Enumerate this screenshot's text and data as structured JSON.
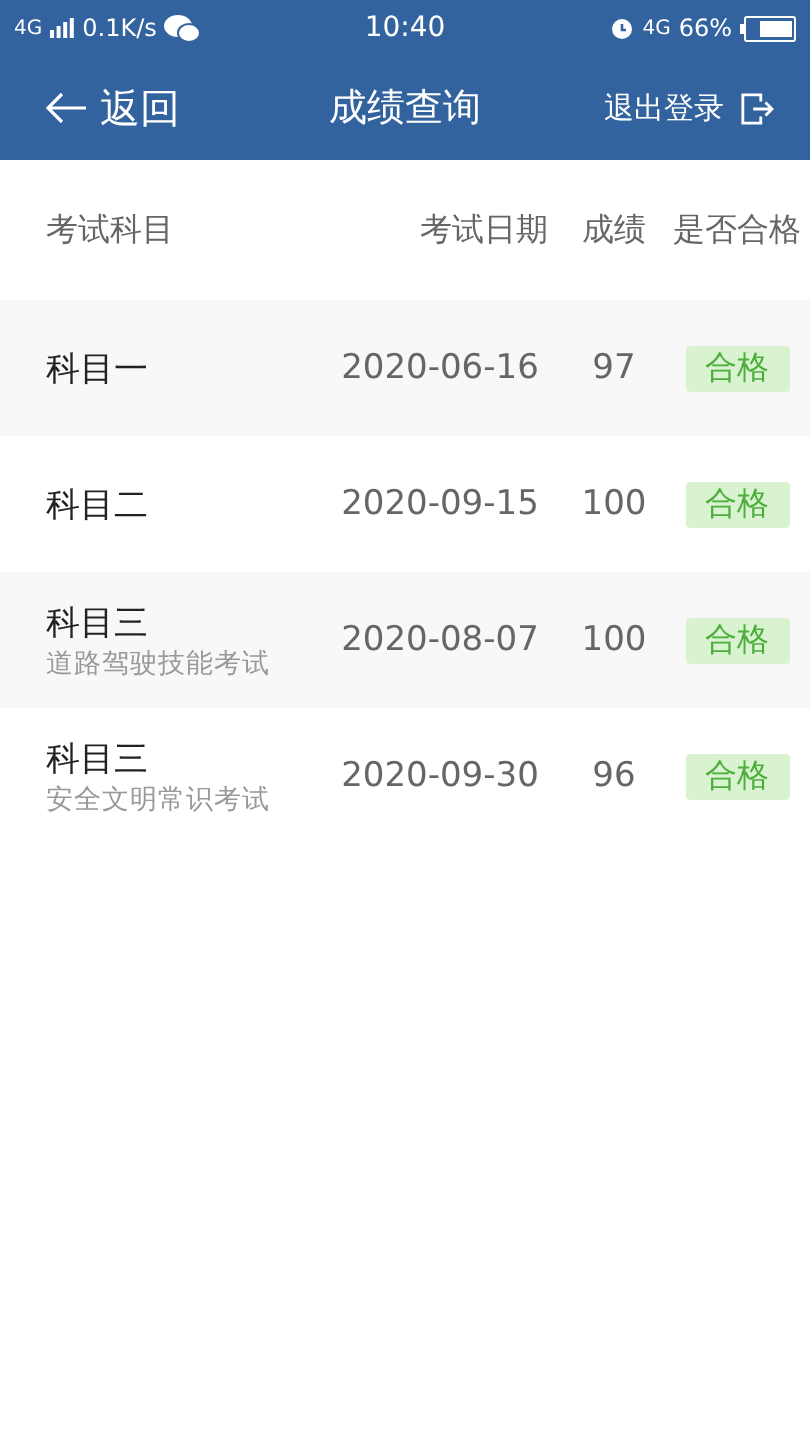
{
  "status_bar": {
    "network": "4G",
    "speed": "0.1K/s",
    "time": "10:40",
    "network_right": "4G",
    "battery": "66%"
  },
  "header": {
    "back": "返回",
    "title": "成绩查询",
    "logout": "退出登录"
  },
  "table": {
    "columns": [
      "考试科目",
      "考试日期",
      "成绩",
      "是否合格"
    ],
    "rows": [
      {
        "subject": "科目一",
        "date": "2020-06-16",
        "score": "97",
        "result": "合格"
      },
      {
        "subject": "科目二",
        "date": "2020-09-15",
        "score": "100",
        "result": "合格"
      },
      {
        "subject": "科目三",
        "note": "道路驾驶技能考试",
        "date": "2020-08-07",
        "score": "100",
        "result": "合格"
      },
      {
        "subject": "科目三",
        "note": "安全文明常识考试",
        "date": "2020-09-30",
        "score": "96",
        "result": "合格"
      }
    ]
  }
}
